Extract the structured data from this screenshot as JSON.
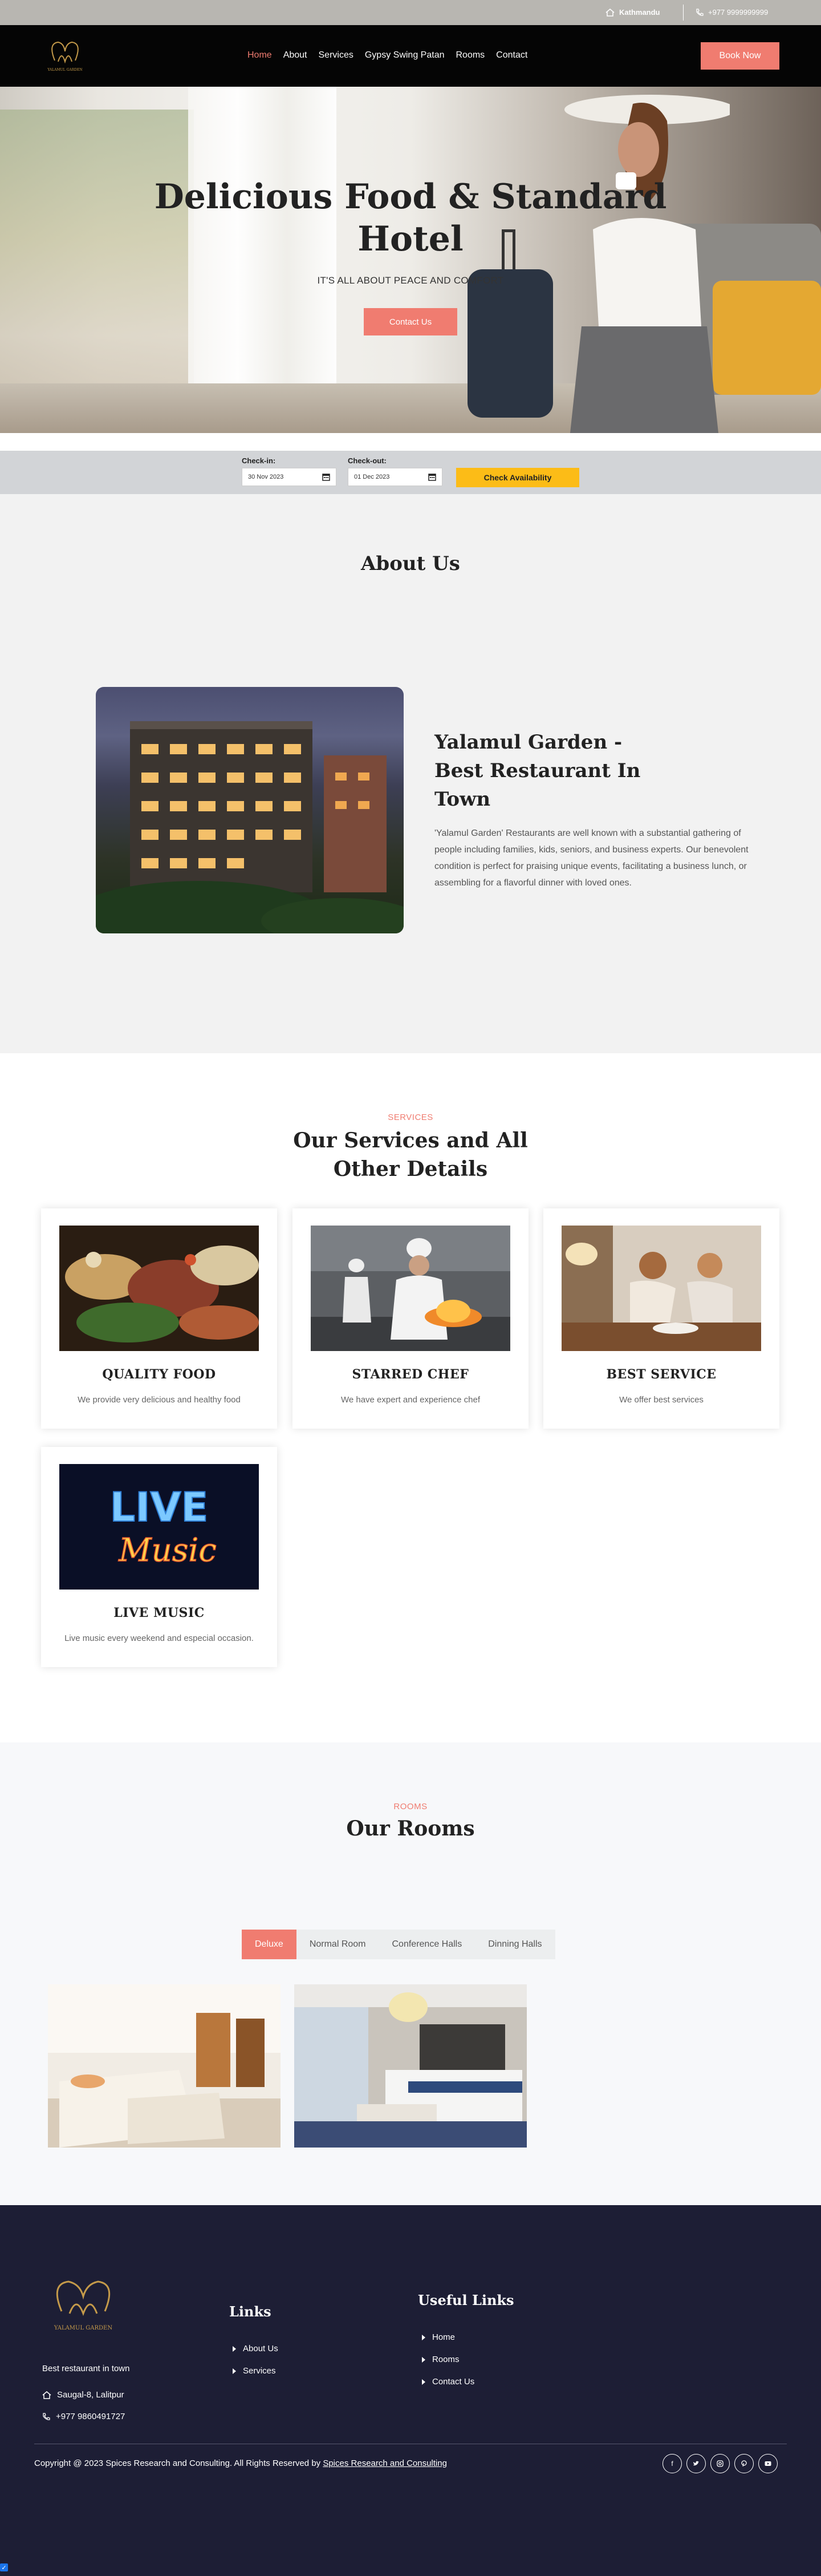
{
  "topbar": {
    "location": "Kathmandu",
    "phone": "+977 9999999999"
  },
  "brand": {
    "logo_text": "YALAMUL GARDEN"
  },
  "nav": {
    "items": [
      "Home",
      "About",
      "Services",
      "Gypsy Swing Patan",
      "Rooms",
      "Contact"
    ],
    "active": "Home",
    "book_label": "Book Now"
  },
  "hero": {
    "title_line1": "Delicious Food & Standard",
    "title_line2": "Hotel",
    "tagline": "IT'S ALL ABOUT PEACE AND COMFORT",
    "cta": "Contact Us"
  },
  "availability": {
    "checkin_label": "Check-in:",
    "checkin_value": "30 Nov 2023",
    "checkout_label": "Check-out:",
    "checkout_value": "01 Dec 2023",
    "button": "Check Availability"
  },
  "about": {
    "heading": "About Us",
    "title": "Yalamul Garden - Best Restaurant In Town",
    "body": "'Yalamul Garden' Restaurants are well known with a substantial gathering of people including families, kids, seniors, and business experts. Our benevolent condition is perfect for praising unique events, facilitating a business lunch, or assembling for a flavorful dinner with loved ones."
  },
  "services": {
    "eyebrow": "SERVICES",
    "heading_line1": "Our Services and All",
    "heading_line2": "Other Details",
    "cards": [
      {
        "title": "QUALITY FOOD",
        "text": "We provide very delicious and healthy food"
      },
      {
        "title": "STARRED CHEF",
        "text": "We have expert and experience chef"
      },
      {
        "title": "BEST SERVICE",
        "text": "We offer best services"
      },
      {
        "title": "LIVE MUSIC",
        "text": "Live music every weekend and especial occasion."
      }
    ],
    "live_sign_top": "LIVE",
    "live_sign_bottom": "Music"
  },
  "rooms": {
    "eyebrow": "ROOMS",
    "heading": "Our Rooms",
    "tabs": [
      "Deluxe",
      "Normal Room",
      "Conference Halls",
      "Dinning Halls"
    ],
    "active_tab": "Deluxe"
  },
  "footer": {
    "logo_text": "YALAMUL GARDEN",
    "tagline": "Best restaurant in town",
    "address": "Saugal-8, Lalitpur",
    "phone": "+977 9860491727",
    "links_heading": "Links",
    "links": [
      "About Us",
      "Services"
    ],
    "useful_heading": "Useful Links",
    "useful": [
      "Home",
      "Rooms",
      "Contact Us"
    ],
    "copyright_prefix": "Copyright @ 2023 Spices Research and Consulting. All Rights Reserved by",
    "copyright_link": "Spices Research and Consulting",
    "social": [
      "facebook-icon",
      "twitter-icon",
      "instagram-icon",
      "pinterest-icon",
      "youtube-icon"
    ]
  },
  "colors": {
    "accent": "#f07c70",
    "availability_button": "#fcbc17",
    "footer_bg": "#1d1e35"
  }
}
